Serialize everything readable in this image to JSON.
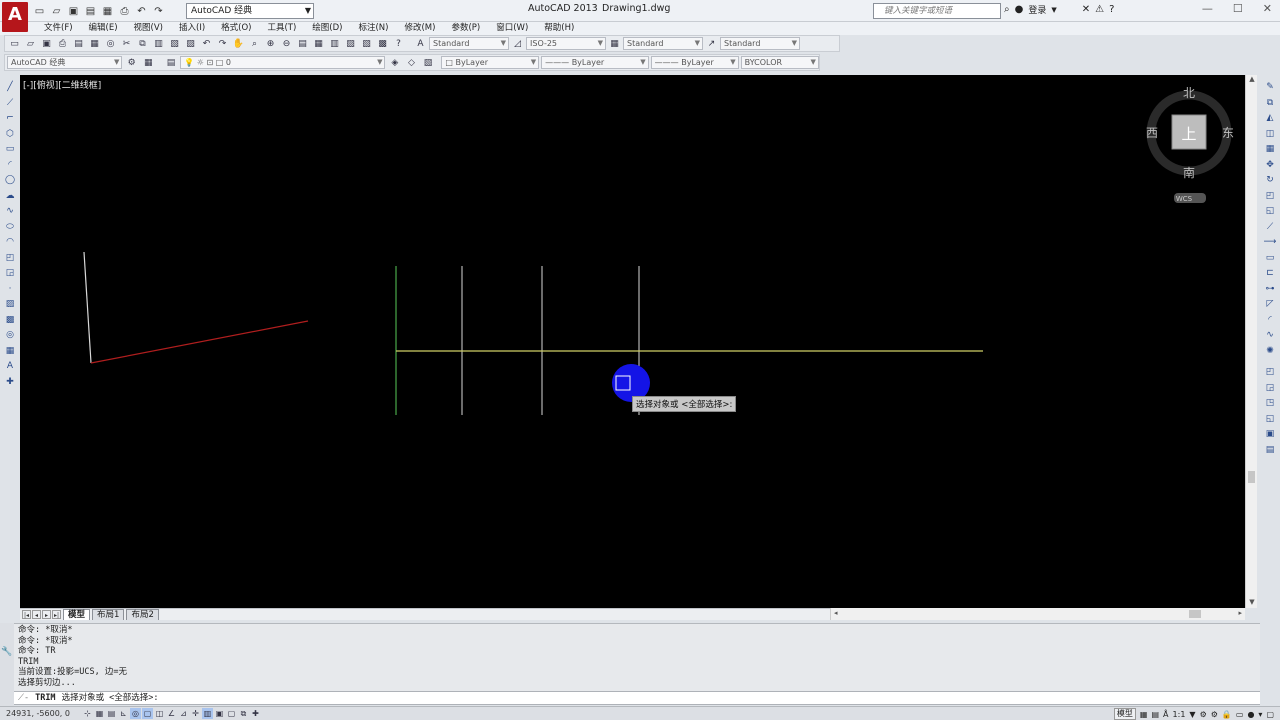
{
  "app": {
    "logo": "A",
    "title": "AutoCAD 2013",
    "file": "Drawing1.dwg",
    "workspace": "AutoCAD 经典",
    "search_placeholder": "键入关键字或短语",
    "login": "登录"
  },
  "menu": [
    "文件(F)",
    "编辑(E)",
    "视图(V)",
    "插入(I)",
    "格式(O)",
    "工具(T)",
    "绘图(D)",
    "标注(N)",
    "修改(M)",
    "参数(P)",
    "窗口(W)",
    "帮助(H)"
  ],
  "styles": {
    "text_style": "Standard",
    "dim_style": "ISO-25",
    "table_style": "Standard",
    "mleader_style": "Standard"
  },
  "layers": {
    "workspace2": "AutoCAD 经典",
    "current_layer": "0",
    "color": "ByLayer",
    "linetype": "ByLayer",
    "lineweight": "ByLayer",
    "plotstyle": "BYCOLOR"
  },
  "viewport": {
    "label": "[-][俯视][二维线框]",
    "tooltip": "选择对象或 <全部选择>:"
  },
  "viewcube": {
    "north": "北",
    "south": "南",
    "east": "东",
    "west": "西",
    "top": "上",
    "wcs": "WCS"
  },
  "tabs": {
    "model": "模型",
    "layout1": "布局1",
    "layout2": "布局2"
  },
  "command": {
    "history": [
      "命令: *取消*",
      "命令: *取消*",
      "命令: TR",
      "TRIM",
      "当前设置:投影=UCS, 边=无",
      "选择剪切边..."
    ],
    "prompt_name": "TRIM",
    "prompt_text": "选择对象或 <全部选择>:"
  },
  "status": {
    "coords": "24931, -5600, 0",
    "model": "模型",
    "annotation_scale": "1:1"
  },
  "colors": {
    "canvas": "#000000",
    "green_line": "#4aa84a",
    "yellow_line": "#cfcf66",
    "red_line": "#b01e1e",
    "white_line": "#d8d8d8",
    "cursor_blue": "#1414e6"
  }
}
